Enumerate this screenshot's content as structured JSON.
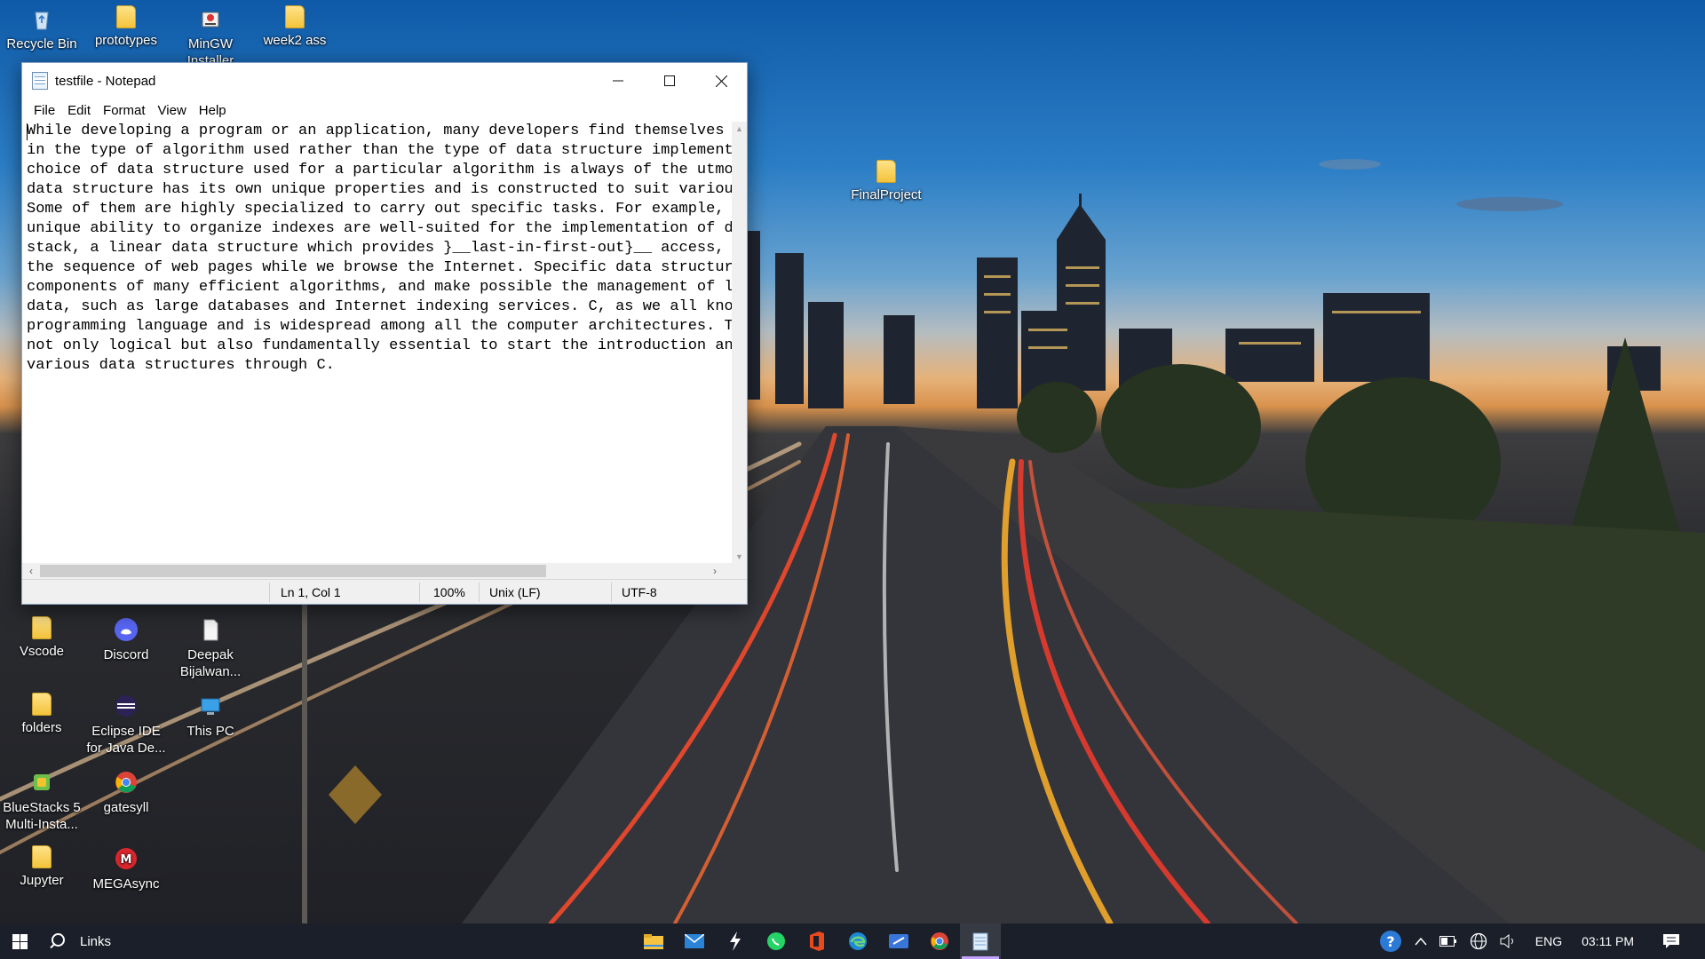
{
  "desktop_icons": {
    "recycle_bin": "Recycle Bin",
    "prototypes": "prototypes",
    "mingw": "MinGW Installer",
    "week2": "week2 ass",
    "final_project": "FinalProject",
    "vscode": "Vscode",
    "discord": "Discord",
    "deepak": "Deepak Bijalwan...",
    "folders": "folders",
    "eclipse": "Eclipse IDE for Java De...",
    "this_pc": "This PC",
    "bluestacks": "BlueStacks 5 Multi-Insta...",
    "gatesyll": "gatesyll",
    "jupyter": "Jupyter",
    "megasync": "MEGAsync"
  },
  "notepad": {
    "title": "testfile - Notepad",
    "menu": [
      "File",
      "Edit",
      "Format",
      "View",
      "Help"
    ],
    "content": "While developing a program or an application, many developers find themselves m\nin the type of algorithm used rather than the type of data structure implemente\nchoice of data structure used for a particular algorithm is always of the utmos\ndata structure has its own unique properties and is constructed to suit various\nSome of them are highly specialized to carry out specific tasks. For example, E\nunique ability to organize indexes are well-suited for the implementation of da\nstack, a linear data structure which provides }__last-in-first-out}__ access, i\nthe sequence of web pages while we browse the Internet. Specific data structure\ncomponents of many efficient algorithms, and make possible the management of la\ndata, such as large databases and Internet indexing services. C, as we all know\nprogramming language and is widespread among all the computer architectures. Th\nnot only logical but also fundamentally essential to start the introduction and\nvarious data structures through C.",
    "status": {
      "position": "Ln 1, Col 1",
      "zoom": "100%",
      "line_ending": "Unix (LF)",
      "encoding": "UTF-8"
    }
  },
  "taskbar": {
    "search_label": "Links",
    "apps": [
      "file-explorer-icon",
      "mail-icon",
      "terminal-icon",
      "whatsapp-icon",
      "office-icon",
      "edge-icon",
      "remote-desktop-icon",
      "chrome-icon",
      "notepad-icon"
    ],
    "language": "ENG",
    "time": "03:11 PM"
  }
}
